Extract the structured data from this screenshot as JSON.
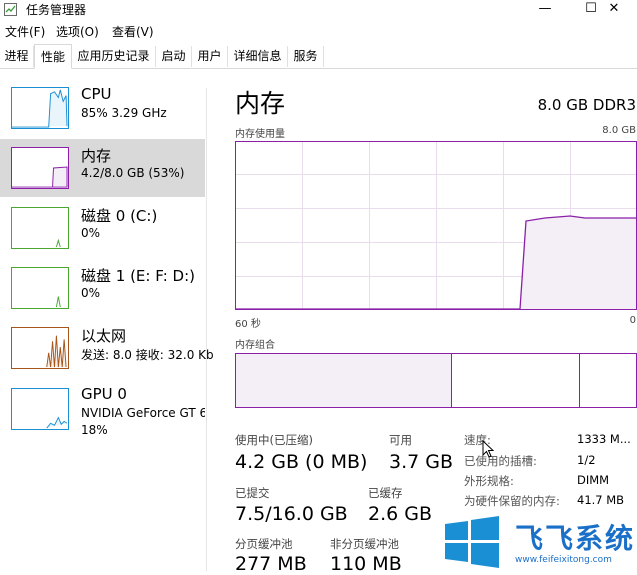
{
  "window": {
    "title": "任务管理器",
    "minimize": "—",
    "maximize": "☐",
    "close": "✕"
  },
  "menu": [
    "文件(F)",
    "选项(O)",
    "查看(V)"
  ],
  "tabs": [
    "进程",
    "性能",
    "应用历史记录",
    "启动",
    "用户",
    "详细信息",
    "服务"
  ],
  "active_tab": "性能",
  "sidebar": [
    {
      "name": "CPU",
      "sub": "85% 3.29 GHz",
      "color": "#1a8fd4"
    },
    {
      "name": "内存",
      "sub": "4.2/8.0 GB (53%)",
      "color": "#8b1fa8"
    },
    {
      "name": "磁盘 0 (C:)",
      "sub": "0%",
      "color": "#4aa832"
    },
    {
      "name": "磁盘 1 (E: F: D:)",
      "sub": "0%",
      "color": "#4aa832"
    },
    {
      "name": "以太网",
      "sub": "发送: 8.0 接收: 32.0 Kb",
      "color": "#a7551b"
    },
    {
      "name": "GPU 0",
      "sub": "NVIDIA GeForce GT 6",
      "sub2": "18%",
      "color": "#1a8fd4"
    }
  ],
  "main": {
    "title": "内存",
    "spec": "8.0 GB DDR3",
    "usage_label": "内存使用量",
    "usage_max": "8.0 GB",
    "time_left": "60 秒",
    "time_right": "0",
    "composition_label": "内存组合"
  },
  "stats": [
    {
      "label": "使用中(已压缩)",
      "value": "4.2 GB (0 MB)"
    },
    {
      "label": "可用",
      "value": "3.7 GB"
    },
    {
      "label": "已提交",
      "value": "7.5/16.0 GB"
    },
    {
      "label": "已缓存",
      "value": "2.6 GB"
    },
    {
      "label": "分页缓冲池",
      "value": "277 MB"
    },
    {
      "label": "非分页缓冲池",
      "value": "110 MB"
    }
  ],
  "details": [
    {
      "label": "速度:",
      "value": "1333 M..."
    },
    {
      "label": "已使用的插槽:",
      "value": "1/2"
    },
    {
      "label": "外形规格:",
      "value": "DIMM"
    },
    {
      "label": "为硬件保留的内存:",
      "value": "41.7 MB"
    }
  ],
  "watermark": {
    "text": "飞飞系统",
    "url": "www.feifeixitong.com"
  },
  "colors": {
    "memory": "#8b1fa8",
    "memory_fill": "#f4eef7",
    "grid": "#e8dced",
    "selected": "#d9d9d9"
  }
}
